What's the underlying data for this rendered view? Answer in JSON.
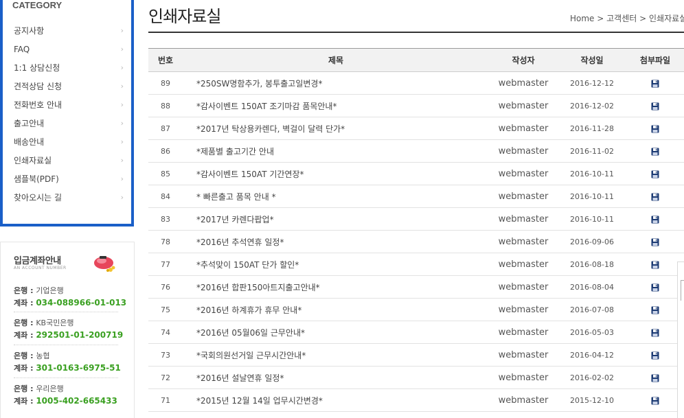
{
  "category": {
    "title": "CATEGORY",
    "items": [
      {
        "label": "공지사항"
      },
      {
        "label": "FAQ"
      },
      {
        "label": "1:1 상담신청"
      },
      {
        "label": "견적상담 신청"
      },
      {
        "label": "전화번호 안내"
      },
      {
        "label": "출고안내"
      },
      {
        "label": "배송안내"
      },
      {
        "label": "인쇄자료실"
      },
      {
        "label": "샘플북(PDF)"
      },
      {
        "label": "찾아오시는 길"
      }
    ],
    "chevron": "›"
  },
  "account": {
    "title": "입금계좌안내",
    "subtitle": "AN ACCOUNT NUMBER",
    "bank_label": "은행 : ",
    "account_label": "계좌 : ",
    "items": [
      {
        "bank": "기업은행",
        "number": "034-088966-01-013"
      },
      {
        "bank": "KB국민은행",
        "number": "292501-01-200719"
      },
      {
        "bank": "농협",
        "number": "301-0163-6975-51"
      },
      {
        "bank": "우리은행",
        "number": "1005-402-665433"
      }
    ]
  },
  "page": {
    "title": "인쇄자료실",
    "breadcrumb": [
      "Home",
      "고객센터",
      "인쇄자료실"
    ],
    "breadcrumb_sep": " > "
  },
  "board": {
    "headers": [
      "번호",
      "제목",
      "작성자",
      "작성일",
      "첨부파일"
    ],
    "rows": [
      {
        "no": "89",
        "title": "*250SW명함추가, 봉투출고일변경*",
        "writer": "webmaster",
        "date": "2016-12-12"
      },
      {
        "no": "88",
        "title": "*감사이벤트 150AT 조기마감 품목안내*",
        "writer": "webmaster",
        "date": "2016-12-02"
      },
      {
        "no": "87",
        "title": "*2017년 탁상용카렌다, 벽걸이 달력 단가*",
        "writer": "webmaster",
        "date": "2016-11-28"
      },
      {
        "no": "86",
        "title": "*제품별 출고기간 안내",
        "writer": "webmaster",
        "date": "2016-11-02"
      },
      {
        "no": "85",
        "title": "*감사이벤트 150AT 기간연장*",
        "writer": "webmaster",
        "date": "2016-10-11"
      },
      {
        "no": "84",
        "title": "* 빠른출고 품목 안내 *",
        "writer": "webmaster",
        "date": "2016-10-11"
      },
      {
        "no": "83",
        "title": "*2017년 카렌다팝업*",
        "writer": "webmaster",
        "date": "2016-10-11"
      },
      {
        "no": "78",
        "title": "*2016년 추석연휴 일정*",
        "writer": "webmaster",
        "date": "2016-09-06"
      },
      {
        "no": "77",
        "title": "*추석맞이 150AT 단가 할인*",
        "writer": "webmaster",
        "date": "2016-08-18"
      },
      {
        "no": "76",
        "title": "*2016년 합판150아트지출고안내*",
        "writer": "webmaster",
        "date": "2016-08-04"
      },
      {
        "no": "75",
        "title": "*2016년 하계휴가 휴무 안내*",
        "writer": "webmaster",
        "date": "2016-07-08"
      },
      {
        "no": "74",
        "title": "*2016년 05월06일 근무안내*",
        "writer": "webmaster",
        "date": "2016-05-03"
      },
      {
        "no": "73",
        "title": "*국회의원선거일 근무시간안내*",
        "writer": "webmaster",
        "date": "2016-04-12"
      },
      {
        "no": "72",
        "title": "*2016년 설날연휴 일정*",
        "writer": "webmaster",
        "date": "2016-02-02"
      },
      {
        "no": "71",
        "title": "*2015년 12월 14일 업무시간변경*",
        "writer": "webmaster",
        "date": "2015-12-10"
      }
    ],
    "attachment_icon": "floppy-disk-icon"
  },
  "colors": {
    "category_border": "#1a5fc8",
    "account_number": "#3aa021",
    "floppy": "#1b3a73"
  }
}
